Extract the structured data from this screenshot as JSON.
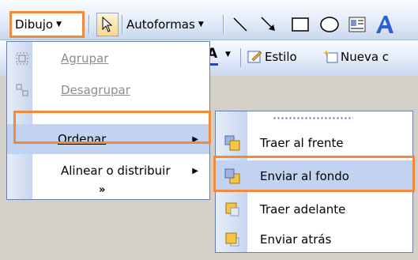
{
  "toolbar": {
    "dibujo_label": "Dibujo",
    "autoformas_label": "Autoformas",
    "estilo_label": "Estilo",
    "nueva_label": "Nueva c"
  },
  "menu": {
    "items": [
      {
        "label": "Agrupar",
        "enabled": false
      },
      {
        "label": "Desagrupar",
        "enabled": false
      },
      {
        "label": "Ordenar",
        "enabled": true,
        "highlighted": true
      },
      {
        "label": "Alinear o distribuir",
        "enabled": true
      }
    ],
    "expand_glyph": "»"
  },
  "submenu": {
    "items": [
      {
        "label": "Traer al frente"
      },
      {
        "label": "Enviar al fondo",
        "highlighted": true
      },
      {
        "label": "Traer adelante"
      },
      {
        "label": "Enviar atrás"
      }
    ]
  },
  "colors": {
    "highlight": "#c2d3f1",
    "annotation_frame": "#f08a3c",
    "toolbar_gradient_top": "#fafbff",
    "toolbar_gradient_bottom": "#c9d7ee"
  }
}
